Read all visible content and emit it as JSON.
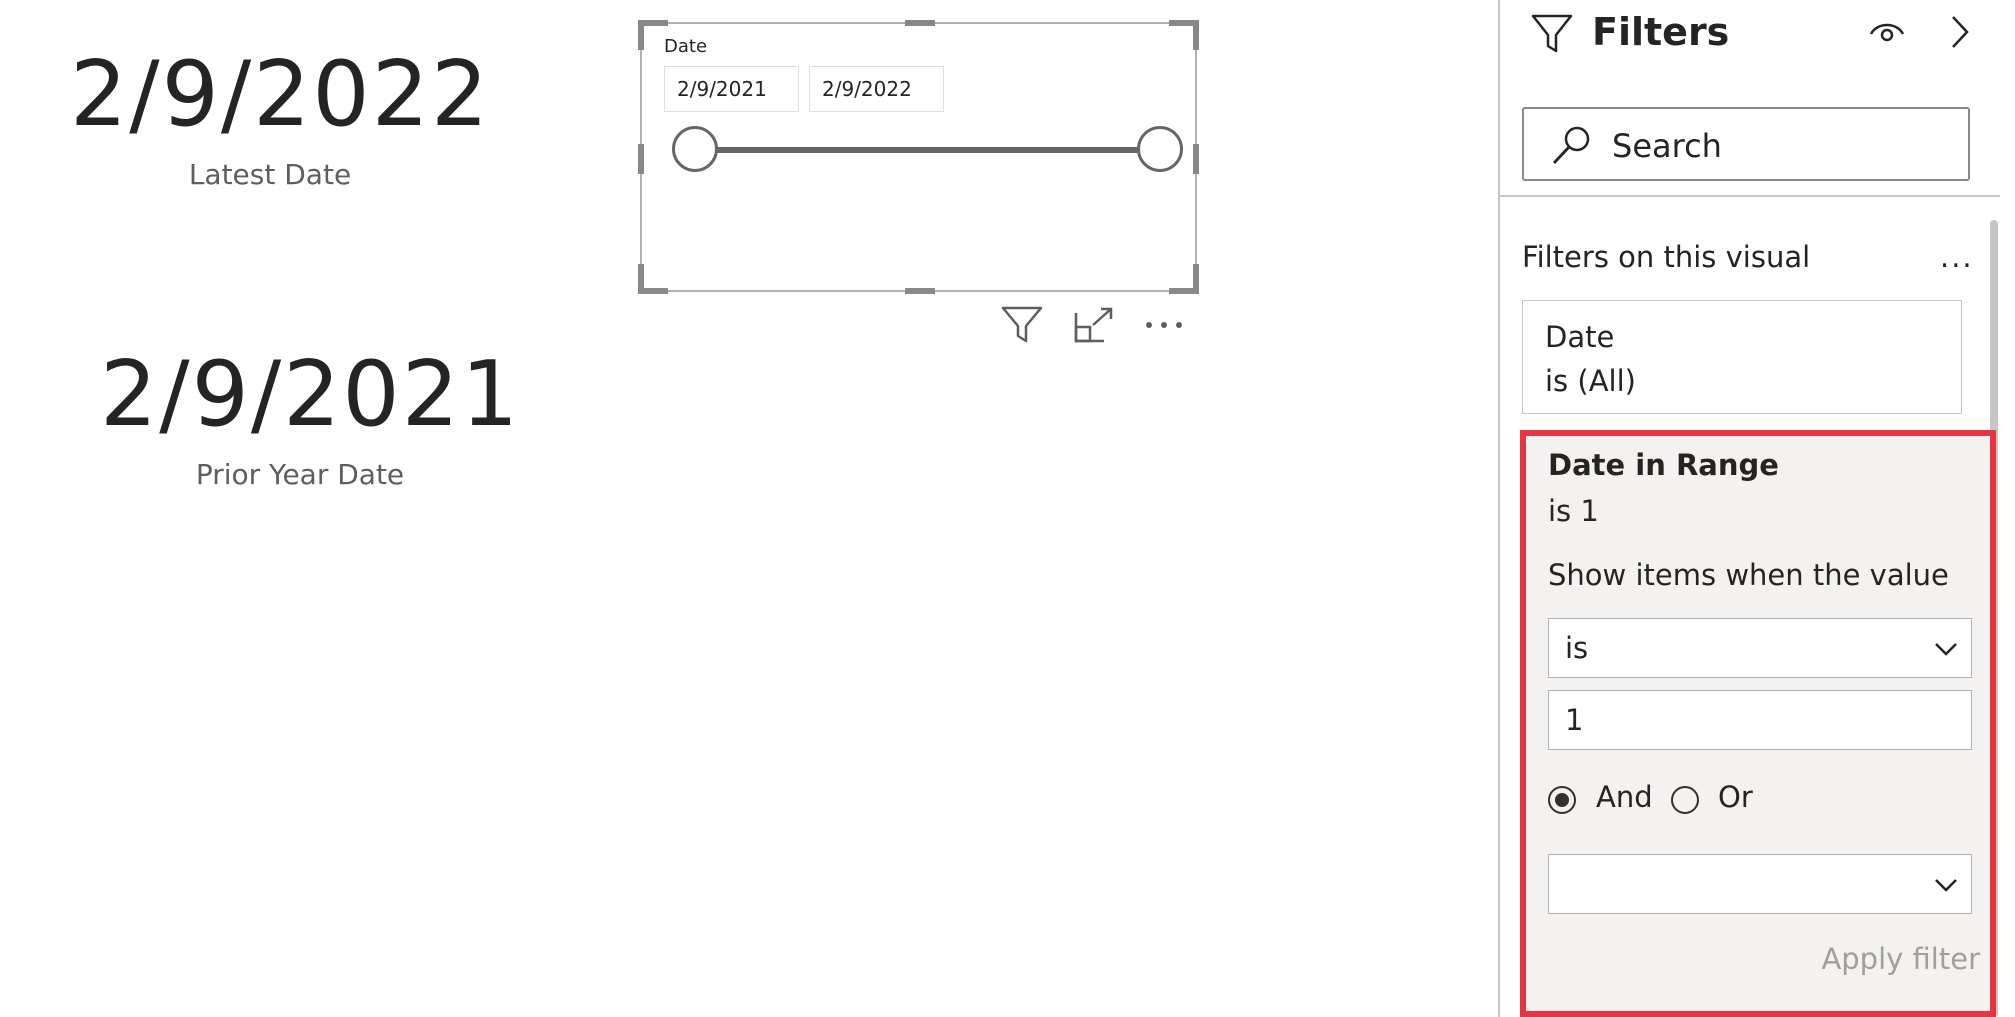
{
  "cards": {
    "latest": {
      "value": "2/9/2022",
      "label": "Latest Date"
    },
    "prior": {
      "value": "2/9/2021",
      "label": "Prior Year Date"
    }
  },
  "slicer": {
    "title": "Date",
    "start_date": "2/9/2021",
    "end_date": "2/9/2022"
  },
  "filters_pane": {
    "title": "Filters",
    "search_label": "Search",
    "section_title": "Filters on this visual",
    "more_label": "...",
    "date_filter": {
      "name": "Date",
      "state": "is (All)"
    },
    "range_filter": {
      "name": "Date in Range",
      "state": "is 1",
      "description": "Show items when the value",
      "operator": "is",
      "value": "1",
      "and_label": "And",
      "or_label": "Or",
      "selected_logic": "And",
      "second_operator": "",
      "apply_label": "Apply filter"
    }
  },
  "colors": {
    "highlight": "#e8343f",
    "text": "#252423",
    "muted": "#605e5c"
  }
}
